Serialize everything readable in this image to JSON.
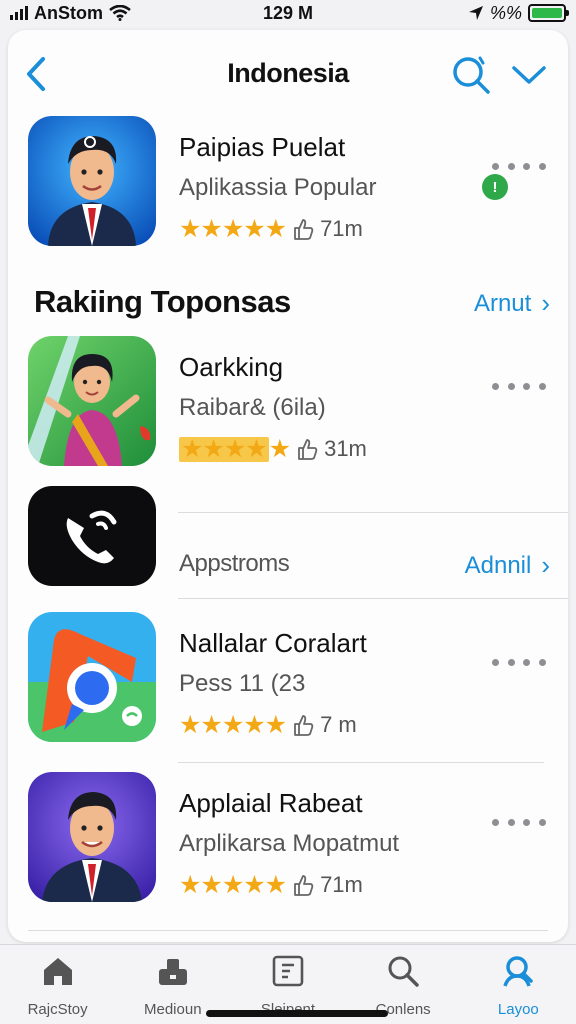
{
  "status_bar": {
    "carrier": "AnStom",
    "time": "129 M",
    "battery_label": "%%"
  },
  "nav": {
    "title": "Indonesia",
    "back_icon": "chevron-left-icon",
    "search_icon": "search-icon",
    "dropdown_icon": "chevron-down-icon"
  },
  "featured": {
    "name": "Paipias Puelat",
    "subtitle": "Aplikassia Popular",
    "rating_stars": 5,
    "downloads": "71m",
    "badge_icon": "info-icon"
  },
  "section": {
    "title": "Rakiing Toponsas",
    "see_all": "Arnut"
  },
  "apps": [
    {
      "name": "Oarkking",
      "subtitle": "Raibar& (6ila)",
      "rating_stars": 5,
      "downloads": "31m"
    },
    {
      "name": "",
      "subtitle": "",
      "downloads": ""
    },
    {
      "name": "Nallalar Coralart",
      "subtitle": "Pess 11 (23",
      "rating_stars": 5,
      "downloads": "7 m"
    },
    {
      "name": "Applaial Rabeat",
      "subtitle": "Arplikarsa Mopatmut",
      "rating_stars": 5,
      "downloads": "71m"
    }
  ],
  "subsection": {
    "title": "Appstroms",
    "see_all": "Adnnil"
  },
  "tabs": [
    {
      "label": "RajcStoy",
      "icon": "home-icon",
      "active": false
    },
    {
      "label": "Medioun",
      "icon": "apps-icon",
      "active": false
    },
    {
      "label": "Sleipent",
      "icon": "document-icon",
      "active": false
    },
    {
      "label": "Conlens",
      "icon": "search-icon",
      "active": false
    },
    {
      "label": "Layoo",
      "icon": "person-icon",
      "active": true
    }
  ],
  "colors": {
    "accent": "#1a8ed8",
    "star": "#f3a815",
    "battery": "#2fb84a"
  }
}
